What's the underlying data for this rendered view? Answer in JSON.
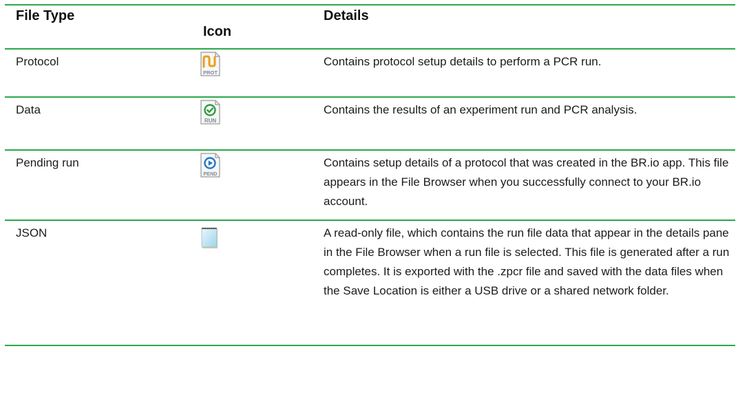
{
  "header": {
    "file_type": "File Type",
    "icon": "Icon",
    "details": "Details"
  },
  "rows": [
    {
      "type": "Protocol",
      "icon_name": "protocol-file-icon",
      "icon_label": "PROT",
      "details": "Contains protocol setup details to perform a PCR run."
    },
    {
      "type": "Data",
      "icon_name": "run-data-file-icon",
      "icon_label": "RUN",
      "details": "Contains the results of an experiment run and PCR analysis."
    },
    {
      "type": "Pending run",
      "icon_name": "pending-run-file-icon",
      "icon_label": "PEND",
      "details": "Contains setup details of a protocol that was created in the BR.io app. This file appears in the File Browser when you successfully connect to your BR.io account."
    },
    {
      "type": "JSON",
      "icon_name": "json-notepad-icon",
      "icon_label": "",
      "details": "A read-only file, which contains the run file data that appear in the details pane in the File Browser when a run file is selected. This file is generated after a run completes. It is exported with the .zpcr file and saved with the data files when the Save Location is either a USB drive or a shared network folder."
    }
  ],
  "colors": {
    "rule": "#2aa84a",
    "prot_accent": "#e8a11c",
    "run_accent": "#2e9e3a",
    "pend_accent": "#1f78c8"
  }
}
